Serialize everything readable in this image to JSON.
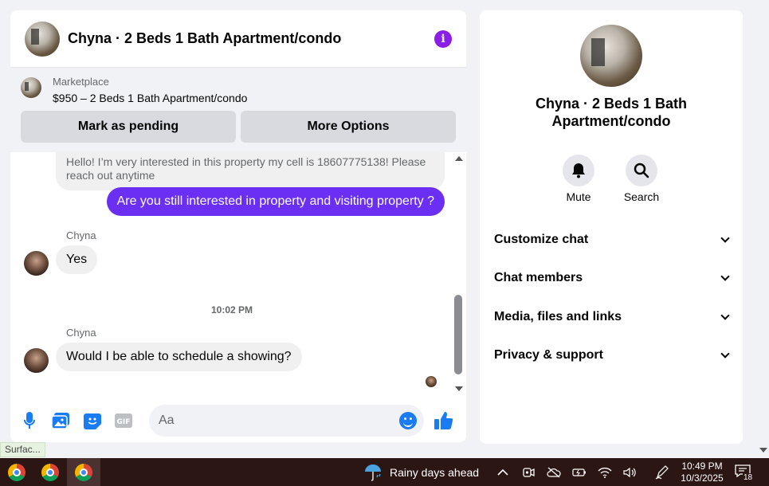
{
  "chat": {
    "title": "Chyna · 2 Beds 1 Bath Apartment/condo",
    "marketplace_label": "Marketplace",
    "listing": "$950 – 2 Beds 1 Bath Apartment/condo",
    "mark_pending": "Mark as pending",
    "more_options": "More Options",
    "messages": {
      "incoming_top": "Hello! I’m very interested in this property my cell is 18607775138! Please reach out anytime",
      "outgoing": "Are you still interested in property and visiting property ?",
      "sender1": "Chyna",
      "reply1": "Yes",
      "timestamp": "10:02 PM",
      "sender2": "Chyna",
      "reply2": "Would I be able to schedule a showing?"
    },
    "composer_placeholder": "Aa"
  },
  "panel": {
    "title": "Chyna · 2 Beds 1 Bath Apartment/condo",
    "mute": "Mute",
    "search": "Search",
    "menu": [
      "Customize chat",
      "Chat members",
      "Media, files and links",
      "Privacy & support"
    ]
  },
  "status_tip": "Surfac...",
  "taskbar": {
    "weather": "Rainy days ahead",
    "time": "10:49 PM",
    "date": "10/3/2025",
    "notifications": "18"
  },
  "colors": {
    "accent": "#6a2ff2",
    "info": "#8a1ee6",
    "like": "#1a7cf5"
  }
}
